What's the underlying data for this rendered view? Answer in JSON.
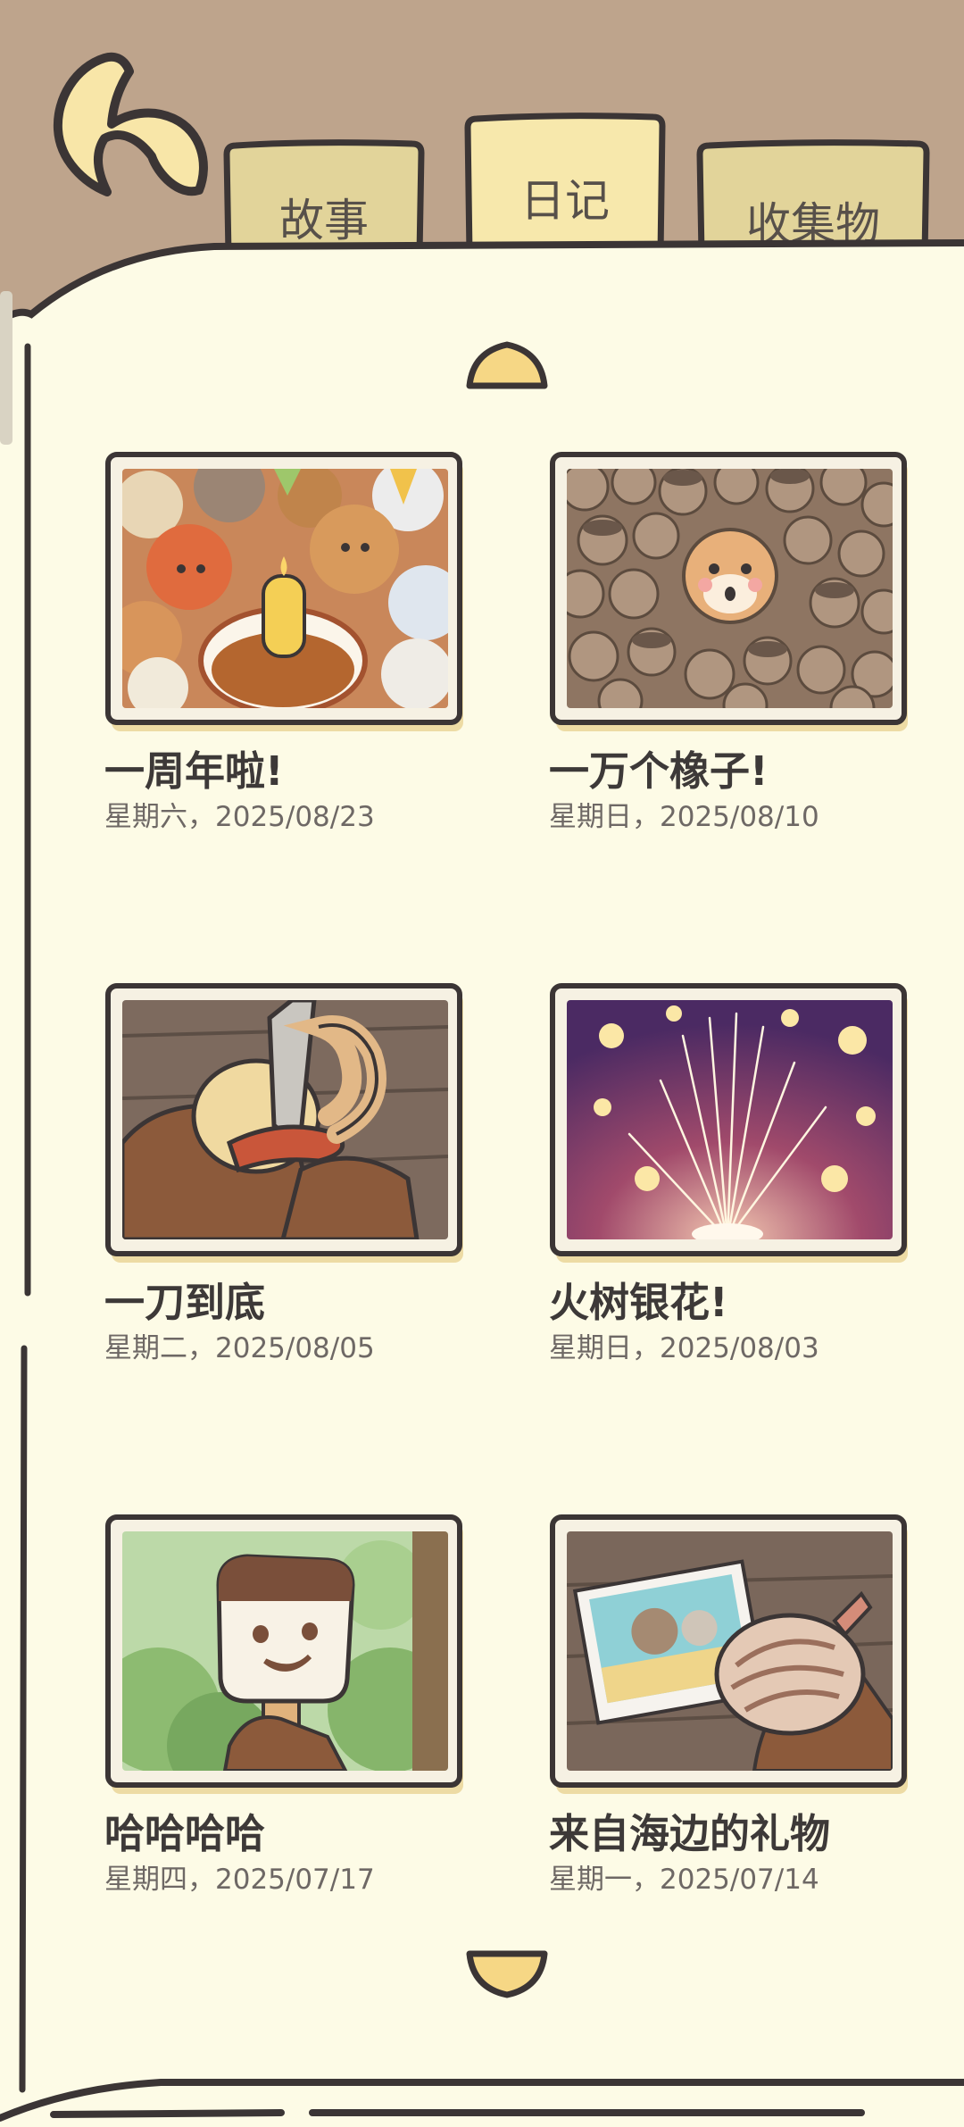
{
  "tabs": {
    "story": "故事",
    "diary": "日记",
    "collection": "收集物"
  },
  "entries": [
    {
      "title": "一周年啦!",
      "date": "星期六，2025/08/23",
      "image": "anniversary-party-cake"
    },
    {
      "title": "一万个橡子!",
      "date": "星期日，2025/08/10",
      "image": "squirrel-in-acorn-pile"
    },
    {
      "title": "一刀到底",
      "date": "星期二，2025/08/05",
      "image": "knife-peeling-fruit"
    },
    {
      "title": "火树银花!",
      "date": "星期日，2025/08/03",
      "image": "fireworks-night"
    },
    {
      "title": "哈哈哈哈",
      "date": "星期四，2025/07/17",
      "image": "ice-cream-bar-face"
    },
    {
      "title": "来自海边的礼物",
      "date": "星期一，2025/07/14",
      "image": "seashell-and-photo"
    }
  ],
  "colors": {
    "background": "#bea48c",
    "paper": "#fdfbe6",
    "tab_active": "#f7e8ac",
    "tab_inactive": "#e2d49a",
    "outline": "#3b3535"
  }
}
